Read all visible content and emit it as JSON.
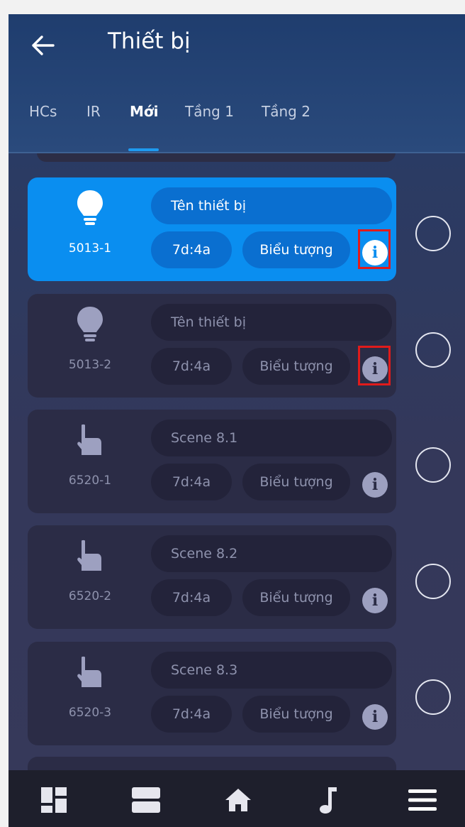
{
  "header": {
    "title": "Thiết bị",
    "back_icon": "arrow-left-icon"
  },
  "tabs": [
    {
      "label": "HCs",
      "active": false
    },
    {
      "label": "IR",
      "active": false
    },
    {
      "label": "Mới",
      "active": true
    },
    {
      "label": "Tầng 1",
      "active": false
    },
    {
      "label": "Tầng 2",
      "active": false
    }
  ],
  "devices": [
    {
      "id": "5013-1",
      "name": "Tên thiết bị",
      "mac": "7d:4a",
      "icon_label": "Biểu tượng",
      "icon": "lightbulb-icon",
      "selected": true,
      "highlighted": true
    },
    {
      "id": "5013-2",
      "name": "Tên thiết bị",
      "mac": "7d:4a",
      "icon_label": "Biểu tượng",
      "icon": "lightbulb-icon",
      "selected": false,
      "highlighted": true
    },
    {
      "id": "6520-1",
      "name": "Scene 8.1",
      "mac": "7d:4a",
      "icon_label": "Biểu tượng",
      "icon": "hand-pointer-icon",
      "selected": false,
      "highlighted": false
    },
    {
      "id": "6520-2",
      "name": "Scene 8.2",
      "mac": "7d:4a",
      "icon_label": "Biểu tượng",
      "icon": "hand-pointer-icon",
      "selected": false,
      "highlighted": false
    },
    {
      "id": "6520-3",
      "name": "Scene 8.3",
      "mac": "7d:4a",
      "icon_label": "Biểu tượng",
      "icon": "hand-pointer-icon",
      "selected": false,
      "highlighted": false
    }
  ],
  "bottom_nav": [
    {
      "icon": "dashboard-icon"
    },
    {
      "icon": "rooms-icon"
    },
    {
      "icon": "home-icon"
    },
    {
      "icon": "music-note-icon"
    },
    {
      "icon": "menu-icon"
    }
  ],
  "colors": {
    "accent": "#0a8ef0",
    "highlight_box": "#e01b1b",
    "card_bg": "#2b2c46",
    "bottom_nav_bg": "#1e1f2c"
  }
}
